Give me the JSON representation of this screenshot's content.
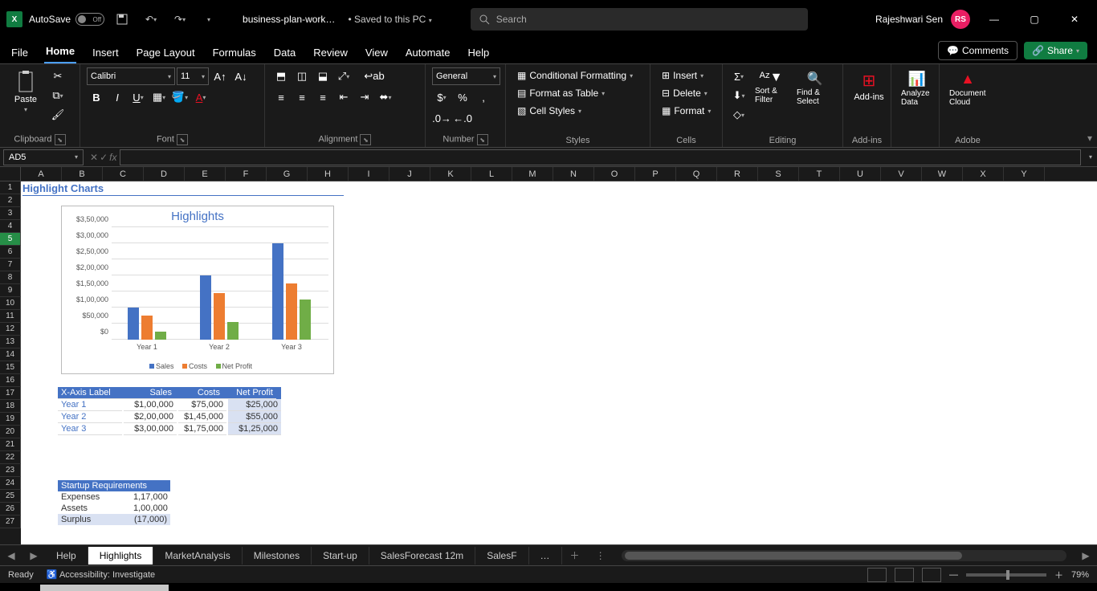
{
  "title_bar": {
    "autosave_label": "AutoSave",
    "autosave_state": "Off",
    "filename": "business-plan-work…",
    "saved_to": "• Saved to this PC",
    "search_placeholder": "Search",
    "user_name": "Rajeshwari Sen",
    "user_initials": "RS"
  },
  "tabs": {
    "items": [
      "File",
      "Home",
      "Insert",
      "Page Layout",
      "Formulas",
      "Data",
      "Review",
      "View",
      "Automate",
      "Help"
    ],
    "active": "Home",
    "comments": "Comments",
    "share": "Share"
  },
  "ribbon": {
    "clipboard": {
      "paste": "Paste",
      "label": "Clipboard"
    },
    "font": {
      "name": "Calibri",
      "size": "11",
      "label": "Font"
    },
    "alignment": {
      "label": "Alignment"
    },
    "number": {
      "format": "General",
      "label": "Number"
    },
    "styles": {
      "cond": "Conditional Formatting",
      "table": "Format as Table",
      "cell": "Cell Styles",
      "label": "Styles"
    },
    "cells": {
      "insert": "Insert",
      "delete": "Delete",
      "format": "Format",
      "label": "Cells"
    },
    "editing": {
      "sort": "Sort & Filter",
      "find": "Find & Select",
      "label": "Editing"
    },
    "addins": {
      "btn": "Add-ins",
      "label": "Add-ins"
    },
    "analyze": {
      "btn": "Analyze Data"
    },
    "adobe": {
      "btn": "Document Cloud",
      "label": "Adobe"
    }
  },
  "formula_bar": {
    "name_box": "AD5",
    "formula": ""
  },
  "columns": [
    "A",
    "B",
    "C",
    "D",
    "E",
    "F",
    "G",
    "H",
    "I",
    "J",
    "K",
    "L",
    "M",
    "N",
    "O",
    "P",
    "Q",
    "R",
    "S",
    "T",
    "U",
    "V",
    "W",
    "X",
    "Y"
  ],
  "rows_visible": 27,
  "selected_row": 5,
  "sheet_title": "Highlight Charts",
  "chart_data": {
    "type": "bar",
    "title": "Highlights",
    "categories": [
      "Year 1",
      "Year 2",
      "Year 3"
    ],
    "series": [
      {
        "name": "Sales",
        "values": [
          100000,
          200000,
          300000
        ]
      },
      {
        "name": "Costs",
        "values": [
          75000,
          145000,
          175000
        ]
      },
      {
        "name": "Net Profit",
        "values": [
          25000,
          55000,
          125000
        ]
      }
    ],
    "ylim": [
      0,
      350000
    ],
    "y_ticks": [
      "$0",
      "$50,000",
      "$1,00,000",
      "$1,50,000",
      "$2,00,000",
      "$2,50,000",
      "$3,00,000",
      "$3,50,000"
    ],
    "legend": [
      "Sales",
      "Costs",
      "Net Profit"
    ]
  },
  "data_table": {
    "headers": [
      "X-Axis Label",
      "Sales",
      "Costs",
      "Net Profit"
    ],
    "rows": [
      {
        "label": "Year 1",
        "sales": "$1,00,000",
        "costs": "$75,000",
        "profit": "$25,000"
      },
      {
        "label": "Year 2",
        "sales": "$2,00,000",
        "costs": "$1,45,000",
        "profit": "$55,000"
      },
      {
        "label": "Year 3",
        "sales": "$3,00,000",
        "costs": "$1,75,000",
        "profit": "$1,25,000"
      }
    ]
  },
  "startup": {
    "title": "Startup Requirements",
    "rows": [
      {
        "label": "Expenses",
        "value": "1,17,000"
      },
      {
        "label": "Assets",
        "value": "1,00,000"
      },
      {
        "label": "Surplus",
        "value": "(17,000)"
      }
    ]
  },
  "sheet_tabs": {
    "items": [
      "Help",
      "Highlights",
      "MarketAnalysis",
      "Milestones",
      "Start-up",
      "SalesForecast 12m",
      "SalesF"
    ],
    "active": "Highlights",
    "more": "…"
  },
  "status_bar": {
    "ready": "Ready",
    "accessibility": "Accessibility: Investigate",
    "zoom": "79%"
  }
}
